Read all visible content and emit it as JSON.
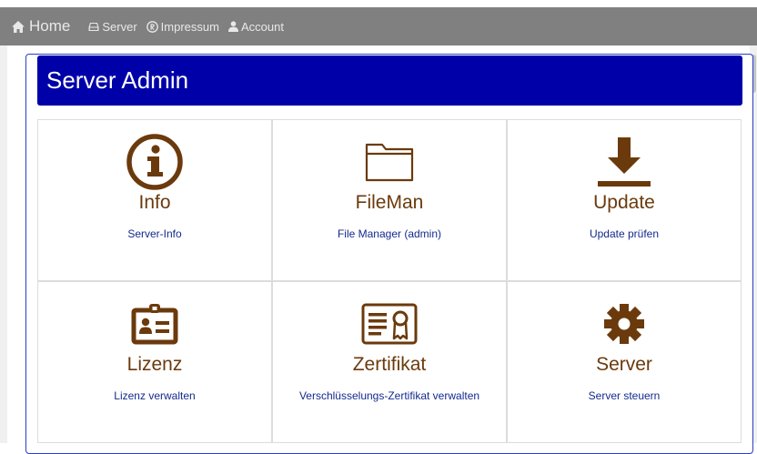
{
  "nav": {
    "home": "Home",
    "server": "Server",
    "impressum": "Impressum",
    "account": "Account"
  },
  "page": {
    "title": "Server Admin"
  },
  "tiles": [
    {
      "title": "Info",
      "subtitle": "Server-Info",
      "icon": "info-circle-icon"
    },
    {
      "title": "FileMan",
      "subtitle": "File Manager (admin)",
      "icon": "folder-icon"
    },
    {
      "title": "Update",
      "subtitle": "Update prüfen",
      "icon": "download-icon"
    },
    {
      "title": "Lizenz",
      "subtitle": "Lizenz verwalten",
      "icon": "id-badge-icon"
    },
    {
      "title": "Zertifikat",
      "subtitle": "Verschlüsselungs-Zertifikat verwalten",
      "icon": "certificate-icon"
    },
    {
      "title": "Server",
      "subtitle": "Server steuern",
      "icon": "gear-icon"
    }
  ],
  "colors": {
    "navbar": "#808080",
    "header": "#0000a8",
    "tile_title": "#6b3a0c",
    "tile_link": "#142a8e"
  }
}
